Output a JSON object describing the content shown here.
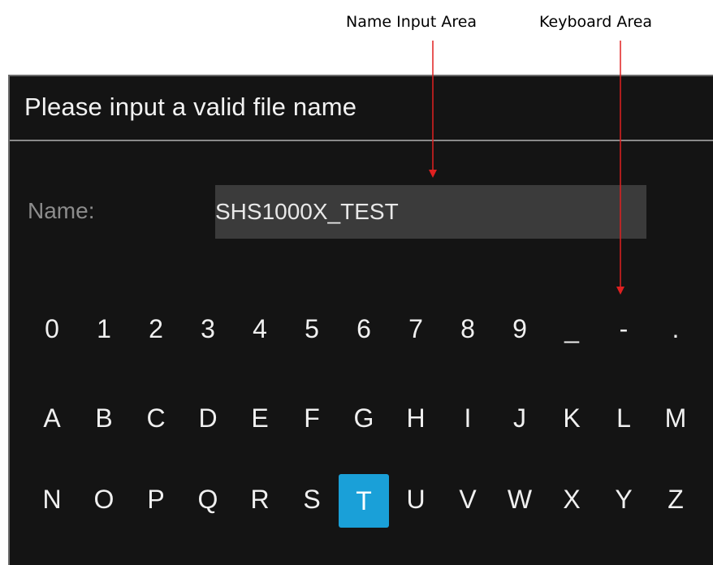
{
  "annotations": {
    "name_input_area": "Name Input Area",
    "keyboard_area": "Keyboard Area"
  },
  "dialog": {
    "title": "Please input a valid file name",
    "name_label": "Name:",
    "name_value": "SHS1000X_TEST"
  },
  "keyboard": {
    "row1": [
      "0",
      "1",
      "2",
      "3",
      "4",
      "5",
      "6",
      "7",
      "8",
      "9",
      "_",
      "-",
      "."
    ],
    "row2": [
      "A",
      "B",
      "C",
      "D",
      "E",
      "F",
      "G",
      "H",
      "I",
      "J",
      "K",
      "L",
      "M"
    ],
    "row3": [
      "N",
      "O",
      "P",
      "Q",
      "R",
      "S",
      "T",
      "U",
      "V",
      "W",
      "X",
      "Y",
      "Z"
    ],
    "selected_key": "T"
  },
  "colors": {
    "dialog_bg": "#141414",
    "field_bg": "#3b3b3b",
    "selected_key_bg": "#1aa0d8",
    "annotation_arrow": "#e02020"
  }
}
